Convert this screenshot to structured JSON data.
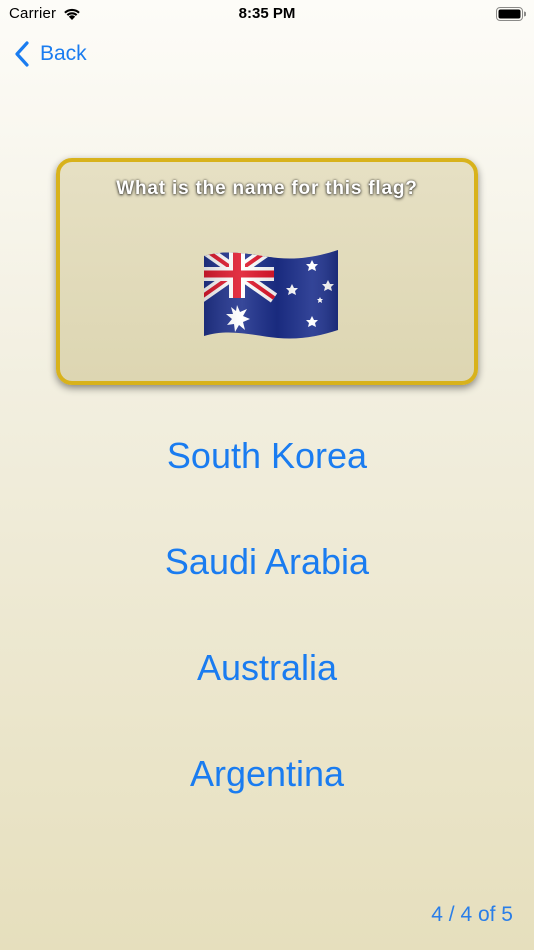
{
  "status_bar": {
    "carrier": "Carrier",
    "time": "8:35 PM"
  },
  "nav": {
    "back_label": "Back"
  },
  "question": {
    "prompt": "What is the name for this flag?",
    "flag_icon": "flag-australia"
  },
  "answers": [
    {
      "label": "South Korea"
    },
    {
      "label": "Saudi Arabia"
    },
    {
      "label": "Australia"
    },
    {
      "label": "Argentina"
    }
  ],
  "progress": {
    "label": "4 / 4 of 5"
  },
  "colors": {
    "accent": "#1a7cf0",
    "card_border": "#d8b21c",
    "flag_blue": "#1c2f8c",
    "flag_red": "#e0162b"
  }
}
